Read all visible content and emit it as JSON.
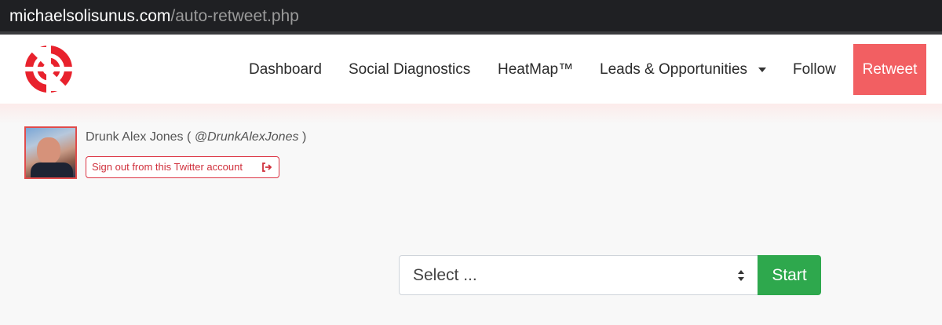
{
  "browser": {
    "url_host": "michaelsolisunus.com",
    "url_path": "/auto-retweet.php"
  },
  "nav": {
    "items": [
      {
        "label": "Dashboard"
      },
      {
        "label": "Social Diagnostics"
      },
      {
        "label": "HeatMap™"
      },
      {
        "label": "Leads & Opportunities"
      },
      {
        "label": "Follow"
      }
    ],
    "active_label": "Retweet",
    "brand_color": "#e8222d",
    "active_color": "#f25f62"
  },
  "account": {
    "name_prefix": "Drunk Alex Jones (",
    "handle": "@DrunkAlexJones",
    "name_suffix": ")",
    "signout_label": "Sign out from this Twitter account",
    "signout_icon": "sign-out-icon"
  },
  "form": {
    "select_value": "Select ...",
    "start_label": "Start",
    "start_color": "#2ea84d"
  }
}
